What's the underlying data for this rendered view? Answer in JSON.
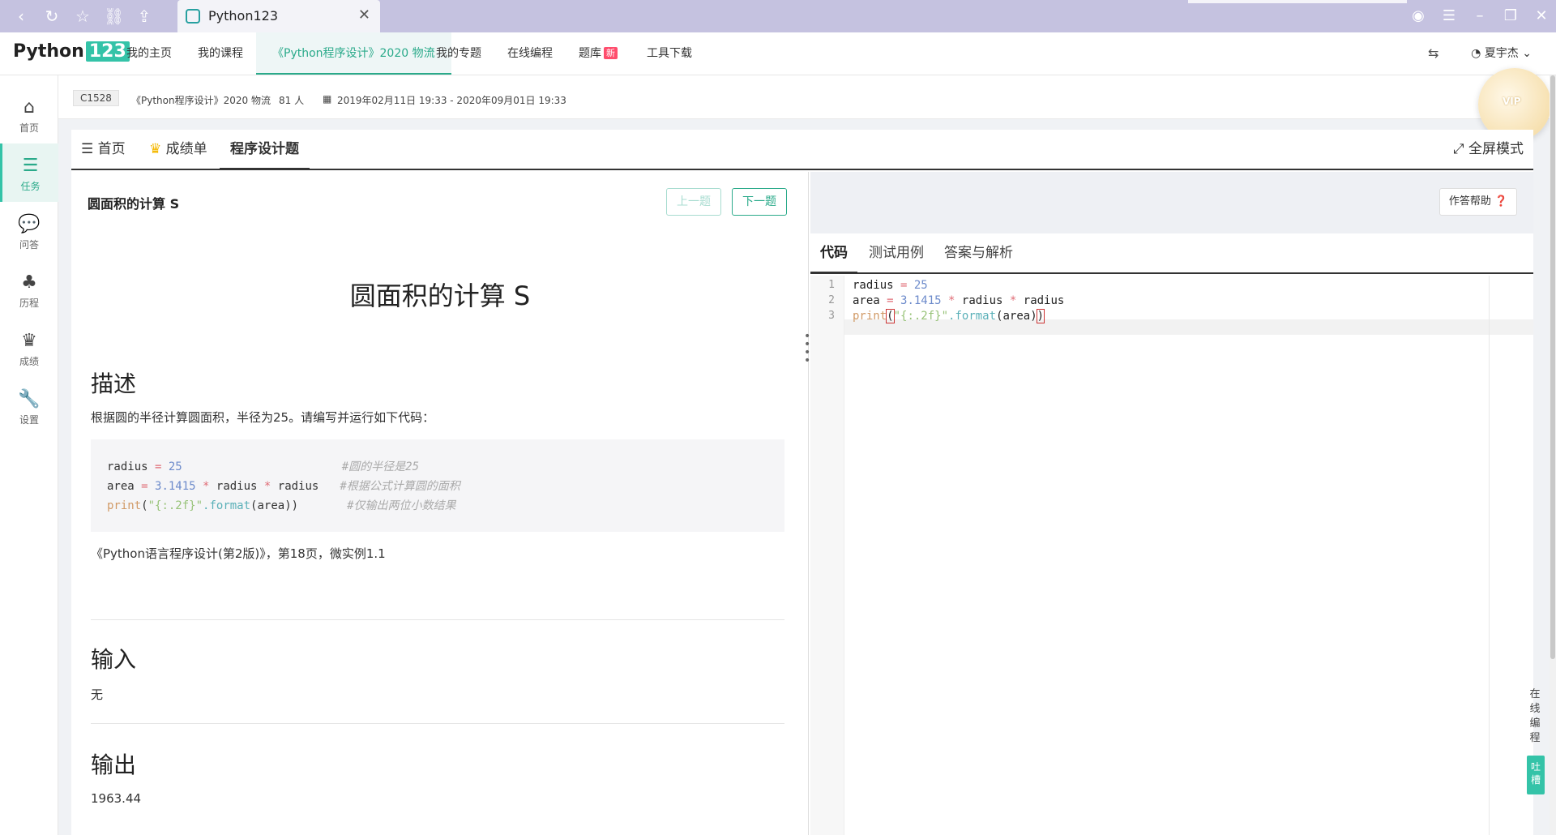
{
  "browser": {
    "tab_title": "Python123",
    "close": "✕"
  },
  "app": {
    "logo_text": "Python",
    "logo_num": "123",
    "nav": [
      "我的主页",
      "我的课程",
      "《Python程序设计》2020 物流",
      "我的专题",
      "在线编程",
      "题库",
      "工具下载"
    ],
    "new_badge": "新",
    "user_name": "夏宇杰"
  },
  "sidebar": {
    "items": [
      {
        "label": "首页",
        "icon": "home-icon"
      },
      {
        "label": "任务",
        "icon": "tasks-icon"
      },
      {
        "label": "问答",
        "icon": "chat-icon"
      },
      {
        "label": "历程",
        "icon": "tree-icon"
      },
      {
        "label": "成绩",
        "icon": "trophy-icon"
      },
      {
        "label": "设置",
        "icon": "wrench-icon"
      }
    ]
  },
  "info": {
    "code": "C1528",
    "course": "《Python程序设计》2020 物流",
    "people": "81 人",
    "time": "2019年02月11日 19:33 - 2020年09月01日 19:33"
  },
  "tabs": {
    "home": "首页",
    "scores": "成绩单",
    "program": "程序设计题",
    "fullscreen": "全屏模式"
  },
  "problem": {
    "header_title": "圆面积的计算 S",
    "prev": "上一题",
    "next": "下一题",
    "title": "圆面积的计算 S",
    "desc_h": "描述",
    "desc": "根据圆的半径计算圆面积，半径为25。请编写并运行如下代码：",
    "code": {
      "l1_a": "radius ",
      "l1_op": "=",
      "l1_num": " 25",
      "l1_cmt": "#圆的半径是25",
      "l2_a": "area ",
      "l2_op": "=",
      "l2_num": " 3.1415 ",
      "l2_op2": "*",
      "l2_b": " radius ",
      "l2_op3": "*",
      "l2_c": " radius",
      "l2_cmt": "#根据公式计算圆的面积",
      "l3_kw": "print",
      "l3_a": "(",
      "l3_str": "\"{:.2f}\"",
      "l3_fn": ".format",
      "l3_b": "(area))",
      "l3_cmt": "#仅输出两位小数结果"
    },
    "ref": "《Python语言程序设计(第2版)》，第18页，微实例1.1",
    "input_h": "输入",
    "input": "无",
    "output_h": "输出",
    "output": "1963.44"
  },
  "editor": {
    "help": "作答帮助",
    "tabs": [
      "代码",
      "测试用例",
      "答案与解析"
    ],
    "lines": [
      "1",
      "2",
      "3"
    ],
    "code": {
      "l1_a": "radius ",
      "l1_op": "=",
      "l1_num": " 25",
      "l2_a": "area ",
      "l2_op": "=",
      "l2_num": " 3.1415 ",
      "l2_op2": "*",
      "l2_b": " radius ",
      "l2_op3": "*",
      "l2_c": " radius",
      "l3_kw": "print",
      "l3_p": "(",
      "l3_str": "\"{:.2f}\"",
      "l3_fn": ".format",
      "l3_b": "(area)",
      "l3_p2": ")"
    }
  },
  "float": {
    "online": [
      "在",
      "线",
      "编",
      "程"
    ],
    "tucao": [
      "吐",
      "槽"
    ],
    "vip": "VIP"
  }
}
